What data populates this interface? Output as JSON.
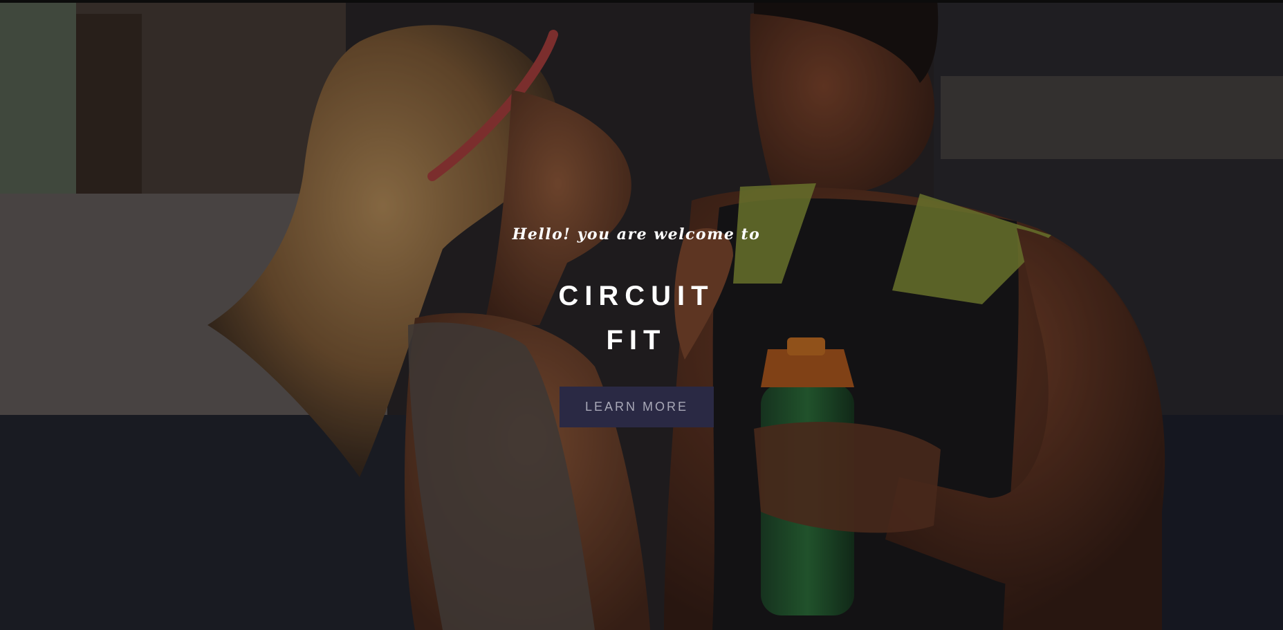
{
  "hero": {
    "greeting": "Hello! you are welcome to",
    "title_line1": "CIRCUIT",
    "title_line2": "FIT",
    "cta_label": "LEARN MORE",
    "background_image": "couple-fitness-photo",
    "cta_color": "#2a2944"
  }
}
